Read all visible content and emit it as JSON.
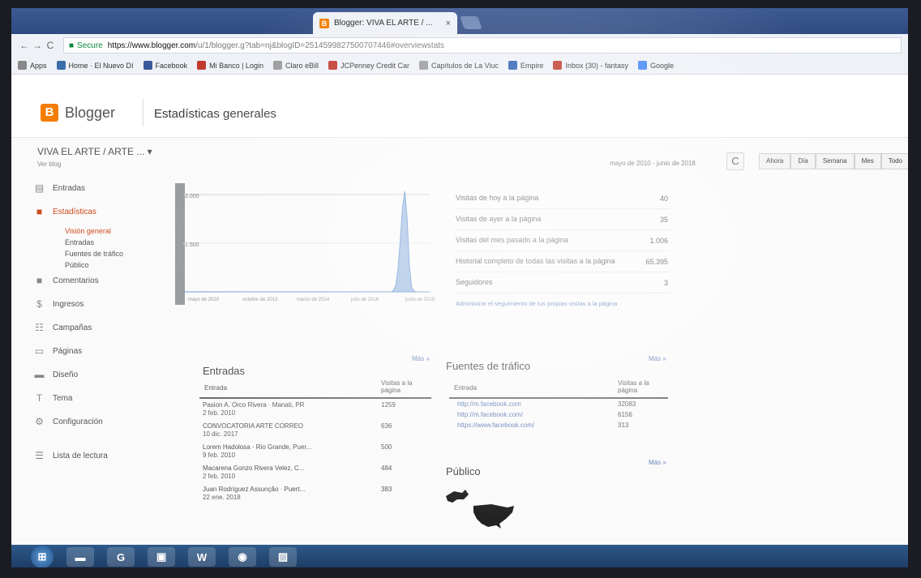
{
  "browser": {
    "tab_title": "Blogger: VIVA EL ARTE / ...",
    "tab_close": "×",
    "nav_back": "←",
    "nav_forward": "→",
    "nav_reload": "C",
    "secure_label": "Secure",
    "url_host": "https://www.blogger.com",
    "url_rest": "/u/1/blogger.g?tab=nj&blogID=2514599827500707446#overviewstats"
  },
  "bookmarks": [
    {
      "label": "Apps",
      "icon": "apps-icon",
      "color": "#888888"
    },
    {
      "label": "Home · El Nuevo Dí",
      "icon": "site-icon",
      "color": "#3b6ea8"
    },
    {
      "label": "Facebook",
      "icon": "facebook-icon",
      "color": "#3b5998"
    },
    {
      "label": "Mi Banco | Login",
      "icon": "bank-icon",
      "color": "#c0392b"
    },
    {
      "label": "Claro eBill",
      "icon": "page-icon",
      "color": "#999999"
    },
    {
      "label": "JCPenney Credit Car",
      "icon": "jcpenney-icon",
      "color": "#c0392b"
    },
    {
      "label": "Capítulos de La Viuc",
      "icon": "page-icon",
      "color": "#999999"
    },
    {
      "label": "Empire",
      "icon": "empire-icon",
      "color": "#2a5db0"
    },
    {
      "label": "Inbox (30) - fantasy",
      "icon": "gmail-icon",
      "color": "#c0392b"
    },
    {
      "label": "Google",
      "icon": "google-icon",
      "color": "#4285f4"
    }
  ],
  "header": {
    "logo_letter": "B",
    "logo_text": "Blogger",
    "page_title": "Estadísticas generales"
  },
  "blog": {
    "name": "VIVA EL ARTE / ARTE ...",
    "sub": "Ver blog"
  },
  "range": {
    "date_label": "mayo de 2010 - junio de 2018",
    "refresh": "C",
    "buttons": [
      "Ahora",
      "Día",
      "Semana",
      "Mes",
      "Todo"
    ]
  },
  "sidebar": {
    "items": [
      {
        "label": "Entradas",
        "icon": "posts-icon",
        "glyph": "▤",
        "active": false
      },
      {
        "label": "Estadísticas",
        "icon": "stats-icon",
        "glyph": "■",
        "active": true
      },
      {
        "label": "Comentarios",
        "icon": "comments-icon",
        "glyph": "■",
        "active": false
      },
      {
        "label": "Ingresos",
        "icon": "earnings-icon",
        "glyph": "$",
        "active": false
      },
      {
        "label": "Campañas",
        "icon": "campaigns-icon",
        "glyph": "☷",
        "active": false
      },
      {
        "label": "Páginas",
        "icon": "pages-icon",
        "glyph": "▭",
        "active": false
      },
      {
        "label": "Diseño",
        "icon": "layout-icon",
        "glyph": "▬",
        "active": false
      },
      {
        "label": "Tema",
        "icon": "theme-icon",
        "glyph": "T",
        "active": false
      },
      {
        "label": "Configuración",
        "icon": "settings-icon",
        "glyph": "⚙",
        "active": false
      }
    ],
    "subitems": [
      "Visión general",
      "Entradas",
      "Fuentes de tráfico",
      "Público"
    ],
    "reading_list": "Lista de lectura"
  },
  "chart_data": {
    "type": "line",
    "ylabels": [
      "3.000",
      "1.500"
    ],
    "ymax": 3000,
    "xlabels": [
      "mayo de 2010",
      "octubre de 2013",
      "marzo de 2014",
      "julio de 2016",
      "junio de 2018"
    ],
    "series": [
      {
        "values": [
          0,
          0,
          0,
          0,
          0,
          0,
          0,
          0,
          0,
          0,
          0,
          0,
          0,
          0,
          0,
          0,
          0,
          0,
          0,
          0,
          0,
          0,
          0,
          0,
          0,
          0,
          0,
          0,
          0,
          0,
          0,
          0,
          0,
          0,
          0,
          0,
          0,
          0,
          0,
          0,
          0,
          0,
          0,
          0,
          0,
          0,
          0,
          0,
          0,
          0,
          0,
          0,
          0,
          0,
          0,
          0,
          0,
          0,
          0,
          0,
          0,
          0,
          0,
          0,
          0,
          0,
          0,
          0,
          0,
          0,
          0,
          0,
          0,
          0,
          0,
          0,
          0,
          0,
          0,
          0,
          0,
          0,
          0,
          0,
          0,
          0,
          0,
          0,
          0,
          0,
          0,
          0,
          0,
          40,
          200,
          700,
          1600,
          2600,
          3100,
          2300,
          800,
          150,
          30,
          0,
          0,
          0,
          0,
          0,
          0,
          0
        ]
      }
    ],
    "color": "#5b8fd1"
  },
  "stats": {
    "rows": [
      {
        "label": "Visitas de hoy a la página",
        "value": "40"
      },
      {
        "label": "Visitas de ayer a la página",
        "value": "35"
      },
      {
        "label": "Visitas del mes pasado a la página",
        "value": "1.006"
      },
      {
        "label": "Historial completo de todas las visitas a la página",
        "value": "65.395"
      },
      {
        "label": "Seguidores",
        "value": "3"
      }
    ],
    "link": "Administrar el seguimiento de tus propias visitas a la página"
  },
  "entries": {
    "title": "Entradas",
    "more": "Más »",
    "col1": "Entrada",
    "col2": "Visitas a la página",
    "rows": [
      {
        "title": "Pasion A. Orco Rivera · Manati, PR",
        "date": "2 feb. 2010",
        "views": "1259"
      },
      {
        "title": "CONVOCATORIA ARTE CORREO",
        "date": "10 dic. 2017",
        "views": "636"
      },
      {
        "title": "Lorem Hadolosa · Rio Grande, Puer...",
        "date": "9 feb. 2010",
        "views": "500"
      },
      {
        "title": "Macarena Gonzo Rivera Velez, C...",
        "date": "2 feb. 2010",
        "views": "484"
      },
      {
        "title": "Juan Rodríguez Assunção · Puert...",
        "date": "22 ene. 2018",
        "views": "383"
      }
    ]
  },
  "traffic": {
    "title": "Fuentes de tráfico",
    "more": "Más »",
    "col1": "Entrada",
    "col2": "Visitas a la página",
    "rows": [
      {
        "url": "http://m.facebook.com",
        "views": "32083"
      },
      {
        "url": "http://m.facebook.com/",
        "views": "6156"
      },
      {
        "url": "https://www.facebook.com/",
        "views": "313"
      }
    ],
    "more2": "Más »"
  },
  "audience": {
    "title": "Público"
  },
  "taskbar": {
    "items": [
      {
        "icon": "windows-start-icon",
        "glyph": "⊞"
      },
      {
        "icon": "file-explorer-icon",
        "glyph": "▬"
      },
      {
        "icon": "chrome-icon",
        "glyph": "G"
      },
      {
        "icon": "media-icon",
        "glyph": "▣"
      },
      {
        "icon": "word-icon",
        "glyph": "W"
      },
      {
        "icon": "app-icon",
        "glyph": "◉"
      },
      {
        "icon": "photo-icon",
        "glyph": "▨"
      }
    ]
  }
}
